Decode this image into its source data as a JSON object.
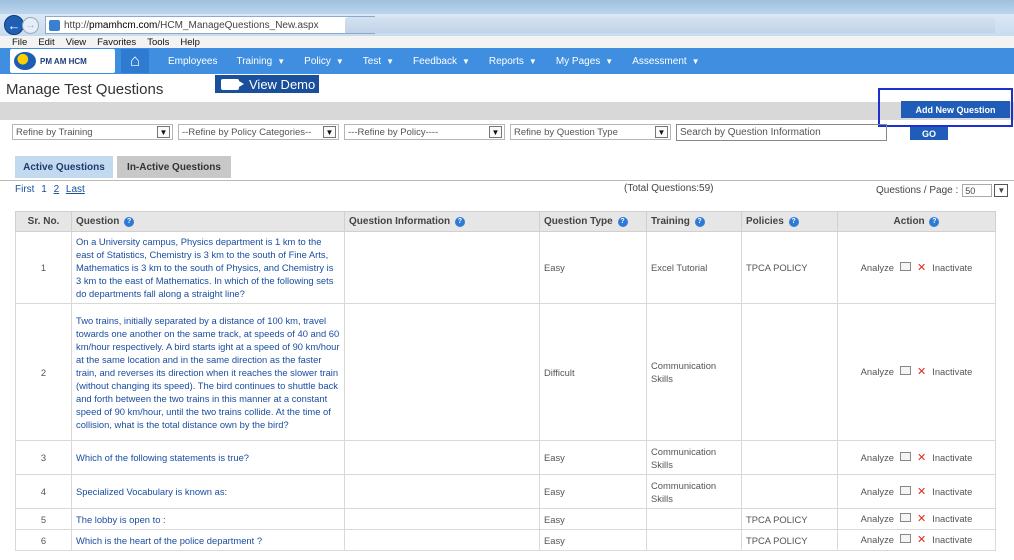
{
  "browser": {
    "url_prefix": "http://",
    "url_host": "pmamhcm.com",
    "url_path": "/HCM_ManageQuestions_New.aspx",
    "menu": [
      "File",
      "Edit",
      "View",
      "Favorites",
      "Tools",
      "Help"
    ]
  },
  "app": {
    "logo_text": "PM AM HCM",
    "nav": [
      {
        "label": "Employees",
        "caret": false
      },
      {
        "label": "Training",
        "caret": true
      },
      {
        "label": "Policy",
        "caret": true
      },
      {
        "label": "Test",
        "caret": true
      },
      {
        "label": "Feedback",
        "caret": true
      },
      {
        "label": "Reports",
        "caret": true
      },
      {
        "label": "My Pages",
        "caret": true
      },
      {
        "label": "Assessment",
        "caret": true
      }
    ]
  },
  "page": {
    "title": "Manage Test Questions",
    "view_demo": "View Demo",
    "add_new": "Add New Question"
  },
  "filters": {
    "training": "Refine by Training",
    "policy_category": "--Refine by Policy Categories--",
    "policy": "---Refine by Policy----",
    "question_type": "Refine by Question Type",
    "search_placeholder": "Search by Question Information",
    "go": "GO"
  },
  "tabs": {
    "active": "Active Questions",
    "inactive": "In-Active Questions"
  },
  "pager": {
    "first": "First",
    "page1": "1",
    "page2": "2",
    "last": "Last",
    "total": "(Total Questions:59)",
    "per_page_label": "Questions / Page :",
    "per_page_value": "50"
  },
  "table": {
    "headers": {
      "sr": "Sr. No.",
      "question": "Question",
      "info": "Question Information",
      "type": "Question Type",
      "training": "Training",
      "policies": "Policies",
      "action": "Action"
    },
    "action_labels": {
      "analyze": "Analyze",
      "inactivate": "Inactivate"
    },
    "rows": [
      {
        "sr": "1",
        "question": "On a University campus, Physics department is 1 km to the east of Statistics, Chemistry is 3 km to the south of Fine Arts, Mathematics is 3 km to the south of Physics, and Chemistry is 3 km to the east of Mathematics. In which of the following sets do departments fall along a straight line?",
        "info": "",
        "type": "Easy",
        "training": "Excel Tutorial",
        "policies": "TPCA POLICY"
      },
      {
        "sr": "2",
        "question": "Two trains, initially separated by a distance of 100 km, travel towards one another on the same track, at speeds of 40 and 60 km/hour respectively. A bird starts ight at a speed of 90 km/hour at the same location and in the same direction as the faster train, and reverses its direction when it reaches the slower train (without changing its speed). The bird continues to shuttle back and forth between the two trains in this manner at a constant speed of 90 km/hour, until the two trains collide. At the time of collision, what is the total distance own by the bird?",
        "info": "",
        "type": "Difficult",
        "training": "Communication Skills",
        "policies": ""
      },
      {
        "sr": "3",
        "question": "Which of the following statements is true?",
        "info": "",
        "type": "Easy",
        "training": "Communication Skills",
        "policies": ""
      },
      {
        "sr": "4",
        "question": "Specialized Vocabulary is known as:",
        "info": "",
        "type": "Easy",
        "training": "Communication Skills",
        "policies": ""
      },
      {
        "sr": "5",
        "question": "The lobby is open to :",
        "info": "",
        "type": "Easy",
        "training": "",
        "policies": "TPCA POLICY"
      },
      {
        "sr": "6",
        "question": "Which is the heart of the police department ?",
        "info": "",
        "type": "Easy",
        "training": "",
        "policies": "TPCA POLICY"
      }
    ]
  }
}
